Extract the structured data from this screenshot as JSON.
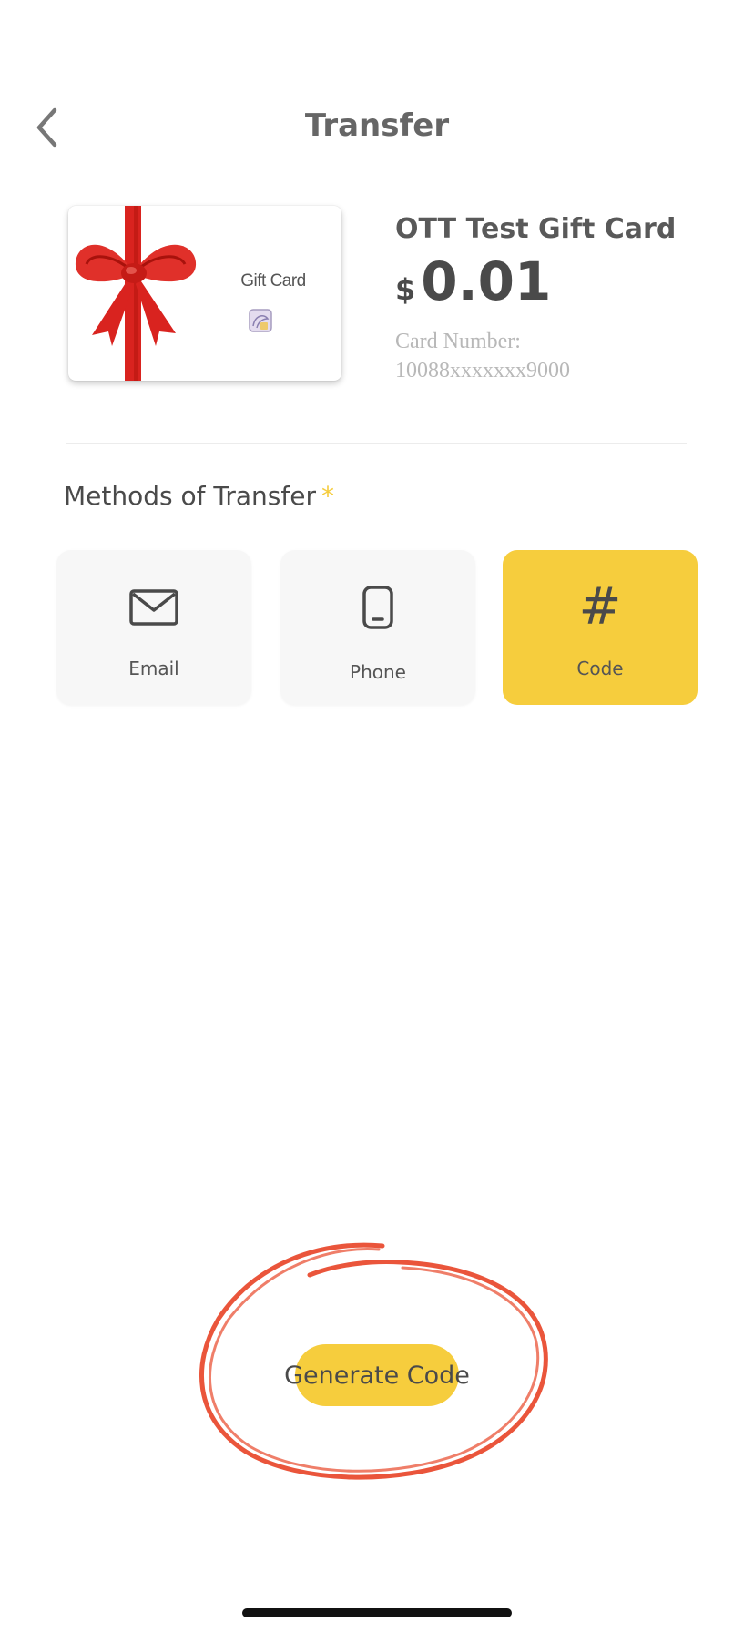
{
  "header": {
    "title": "Transfer"
  },
  "card": {
    "image_text": "Gift Card",
    "name": "OTT Test Gift Card",
    "currency_symbol": "$",
    "amount": "0.01",
    "number_label": "Card Number:",
    "number_value": "10088xxxxxxx9000"
  },
  "methods": {
    "label": "Methods of Transfer",
    "required_mark": "*",
    "options": [
      {
        "label": "Email",
        "icon": "envelope-icon",
        "selected": false
      },
      {
        "label": "Phone",
        "icon": "smartphone-icon",
        "selected": false
      },
      {
        "label": "Code",
        "icon": "hash-icon",
        "selected": true
      }
    ],
    "hash_glyph": "#"
  },
  "action": {
    "generate_label": "Generate Code"
  },
  "colors": {
    "accent": "#f6cd3d",
    "annotation": "#e8472a",
    "ribbon": "#d9231f"
  }
}
